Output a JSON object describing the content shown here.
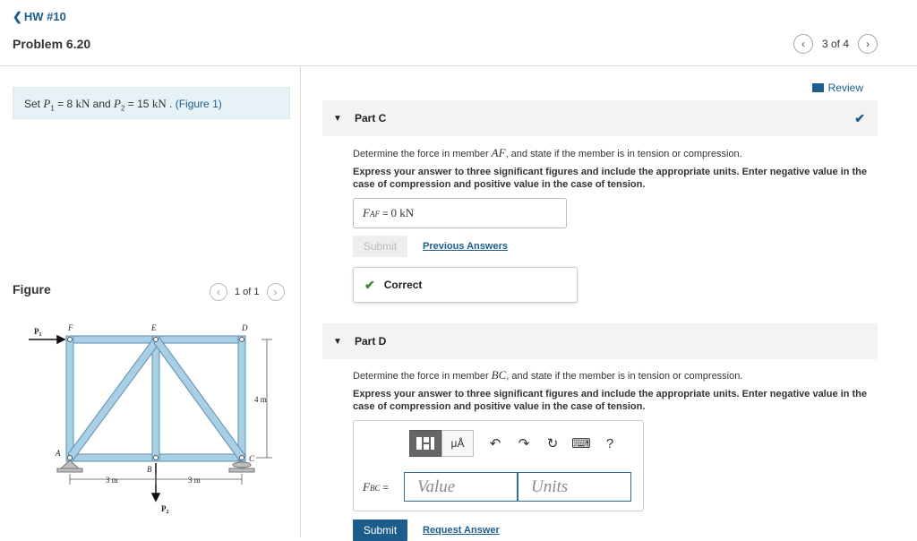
{
  "header": {
    "back_label": "HW #10",
    "problem_title": "Problem 6.20",
    "pager_text": "3 of 4"
  },
  "statement": {
    "prefix": "Set ",
    "p1_sym": "P",
    "p1_sub": "1",
    "p1_eq": " = 8 ",
    "p1_unit": "kN",
    "and": " and ",
    "p2_sym": "P",
    "p2_sub": "2",
    "p2_eq": " = 15 ",
    "p2_unit": "kN",
    "period": " . ",
    "figure_link": "(Figure 1)"
  },
  "figure": {
    "title": "Figure",
    "pager_text": "1 of 1",
    "labels": {
      "p1": "P",
      "p1_sub": "1",
      "p2": "P",
      "p2_sub": "2",
      "F": "F",
      "E": "E",
      "D": "D",
      "A": "A",
      "B": "B",
      "C": "C",
      "height": "4 m",
      "span1": "3 m",
      "span2": "3 m"
    }
  },
  "review_label": "Review",
  "part_c": {
    "label": "Part C",
    "question_pre": "Determine the force in member ",
    "member": "AF",
    "question_post": ", and state if the member is in tension or compression.",
    "instructions": "Express your answer to three significant figures and include the appropriate units. Enter negative value in the case of compression and positive value in the case of tension.",
    "answer_var": "F",
    "answer_sub": "AF",
    "answer_eq": " =  ",
    "answer_value": "0 kN",
    "submit_label": "Submit",
    "previous_answers": "Previous Answers",
    "feedback": "Correct"
  },
  "part_d": {
    "label": "Part D",
    "question_pre": "Determine the force in member ",
    "member": "BC",
    "question_post": ", and state if the member is in tension or compression.",
    "instructions": "Express your answer to three significant figures and include the appropriate units. Enter negative value in the case of compression and positive value in the case of tension.",
    "answer_var": "F",
    "answer_sub": "BC",
    "answer_eq": " =",
    "value_placeholder": "Value",
    "units_placeholder": "Units",
    "toolbar_mu": "μÅ",
    "toolbar_help": "?",
    "submit_label": "Submit",
    "request_answer": "Request Answer"
  },
  "colors": {
    "accent": "#1c5d8c",
    "setbox_bg": "#e6f2f5",
    "truss": "#a9cfe4",
    "success": "#3b8b2a"
  }
}
